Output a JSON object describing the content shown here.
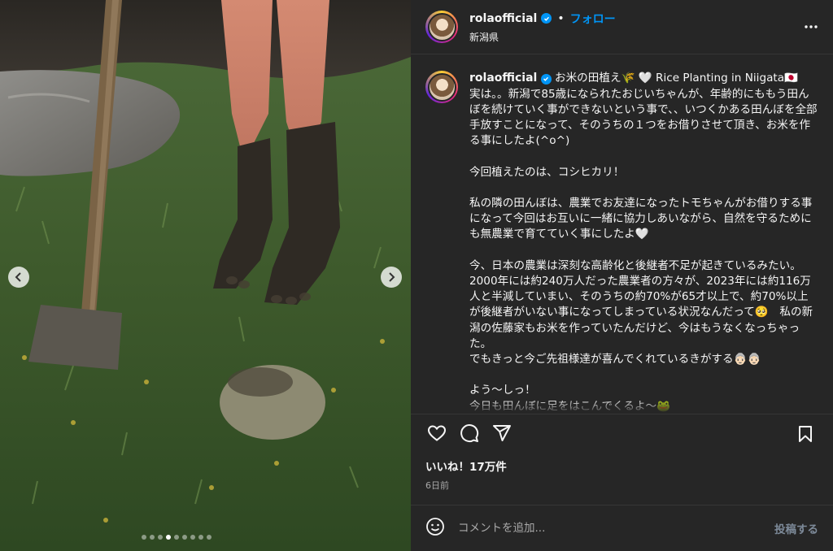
{
  "header": {
    "username": "rolaofficial",
    "separator": "•",
    "follow_label": "フォロー",
    "location": "新潟県"
  },
  "caption": {
    "username": "rolaofficial",
    "text": "お米の田植え🌾 🤍 Rice Planting in Niigata🇯🇵\n実は。。新潟で85歳になられたおじいちゃんが、年齢的にももう田んぼを続けていく事ができないという事で、、いつくかある田んぼを全部手放すことになって、そのうちの１つをお借りさせて頂き、お米を作る事にしたよ(^o^)\n\n今回植えたのは、コシヒカリ！\n\n私の隣の田んぼは、農業でお友達になったトモちゃんがお借りする事になって今回はお互いに一緒に協力しあいながら、自然を守るためにも無農業で育てていく事にしたよ🤍\n\n今、日本の農業は深刻な高齢化と後継者不足が起きているみたい。\n2000年には約240万人だった農業者の方々が、2023年には約116万人と半減していまい、そのうちの約70%が65才以上で、約70%以上が後継者がいない事になってしまっている状況なんだって🥺　私の新潟の佐藤家もお米を作っていたんだけど、今はもうなくなっちゃった。\nでもきっと今ご先祖様達が喜んでくれているきがする👵🏻👵🏻\n\nよう〜しっ！\n今日も田んぼに足をはこんでくるよ〜🐸"
  },
  "engagement": {
    "likes": "いいね！17万件",
    "time_ago": "6日前"
  },
  "comment": {
    "placeholder": "コメントを追加...",
    "post_label": "投稿する"
  },
  "carousel": {
    "total": 9,
    "active_index": 3
  },
  "colors": {
    "panel_bg": "#262626",
    "accent": "#0095f6",
    "muted": "#a8a8a8"
  },
  "icons": [
    "heart-icon",
    "comment-icon",
    "share-icon",
    "bookmark-icon",
    "more-icon",
    "emoji-icon",
    "verified-icon",
    "chevron-left-icon",
    "chevron-right-icon"
  ]
}
